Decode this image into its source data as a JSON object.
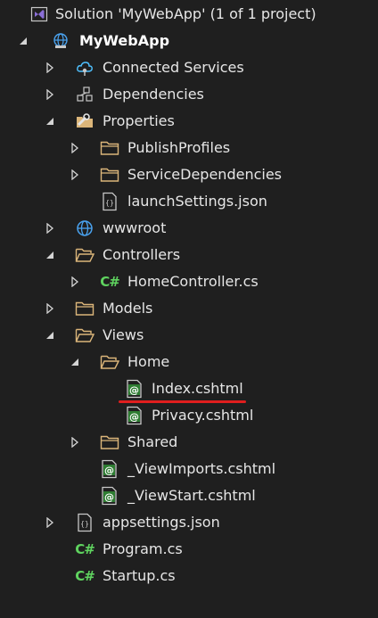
{
  "solution_explorer": {
    "solution_title": "Solution 'MyWebApp' (1 of 1 project)",
    "project_name": "MyWebApp",
    "items": {
      "connected_services": "Connected Services",
      "dependencies": "Dependencies",
      "properties": "Properties",
      "publish_profiles": "PublishProfiles",
      "service_dependencies": "ServiceDependencies",
      "launch_settings": "launchSettings.json",
      "wwwroot": "wwwroot",
      "controllers": "Controllers",
      "home_controller": "HomeController.cs",
      "models": "Models",
      "views": "Views",
      "home": "Home",
      "index_cshtml": "Index.cshtml",
      "privacy_cshtml": "Privacy.cshtml",
      "shared": "Shared",
      "view_imports": "_ViewImports.cshtml",
      "view_start": "_ViewStart.cshtml",
      "appsettings": "appsettings.json",
      "program_cs": "Program.cs",
      "startup_cs": "Startup.cs"
    },
    "icon_glyphs": {
      "csharp": "C#",
      "razor": "@",
      "json": "{}"
    },
    "colors": {
      "background": "#1f1f1f",
      "text": "#e6e6e6",
      "folder": "#dcb67a",
      "csharp": "#5fd35f",
      "razor": "#5fd35f",
      "globe": "#4aa3f0",
      "solution": "#8a6ed6",
      "highlight_underline": "#e01e1e"
    }
  }
}
